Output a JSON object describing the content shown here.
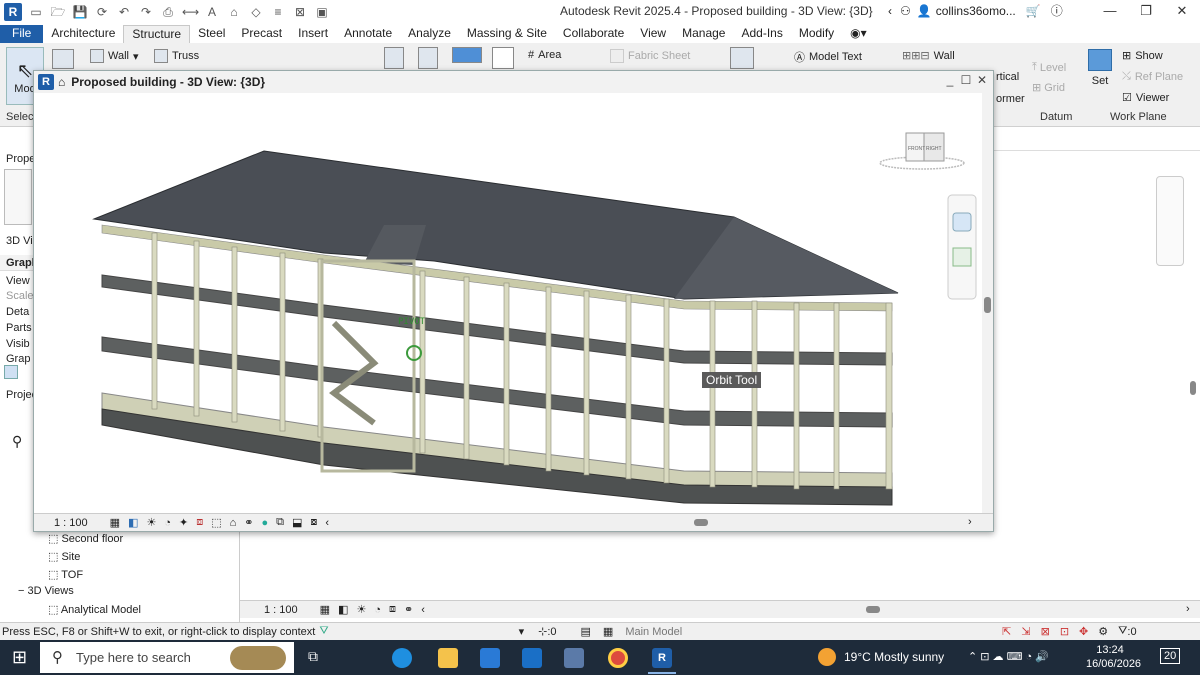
{
  "app": {
    "title": "Autodesk Revit 2025.4 - Proposed building - 3D View: {3D}",
    "user": "collins36omo...",
    "logo": "R"
  },
  "ribbon": {
    "tabs": [
      "File",
      "Architecture",
      "Structure",
      "Steel",
      "Precast",
      "Insert",
      "Annotate",
      "Analyze",
      "Massing & Site",
      "Collaborate",
      "View",
      "Manage",
      "Add-Ins",
      "Modify"
    ],
    "active_tab": "Structure",
    "buttons": {
      "modify": "Mod",
      "wall": "Wall",
      "truss": "Truss",
      "area": "Area",
      "fabric_sheet": "Fabric Sheet",
      "model_text": "Model Text",
      "wall_right": "Wall",
      "vertical": "rtical",
      "dormer": "ormer",
      "level": "Level",
      "grid": "Grid",
      "set": "Set",
      "show": "Show",
      "ref_plane": "Ref Plane",
      "viewer": "Viewer"
    },
    "panels": {
      "select": "Selec",
      "datum": "Datum",
      "work_plane": "Work Plane"
    }
  },
  "properties": {
    "header": "Prope",
    "view_type": "3D Vi",
    "section_graphics": "Graph",
    "rows": [
      "View",
      "Scale",
      "Deta",
      "Parts",
      "Visib",
      "Grap"
    ],
    "project_browser": "Projec",
    "tree": {
      "second_floor": "Second floor",
      "site": "Site",
      "tof": "TOF",
      "views_3d": "3D Views",
      "analytical": "Analytical Model"
    }
  },
  "view_window": {
    "title": "Proposed building - 3D View: {3D}",
    "scale": "1 : 100",
    "pivot_label": "PIVOT",
    "tooltip": "Orbit Tool",
    "viewcube_labels": [
      "FRONT",
      "RIGHT"
    ]
  },
  "bg_view": {
    "scale": "1 : 100"
  },
  "status": {
    "message": "Press ESC, F8 or Shift+W to exit, or right-click to display context",
    "selection_count": ":0",
    "model": "Main Model",
    "filter_count": ":0"
  },
  "taskbar": {
    "search_placeholder": "Type here to search",
    "weather": "19°C  Mostly sunny",
    "time": "13:24",
    "date": "16/06/2026",
    "notifications": "20"
  }
}
